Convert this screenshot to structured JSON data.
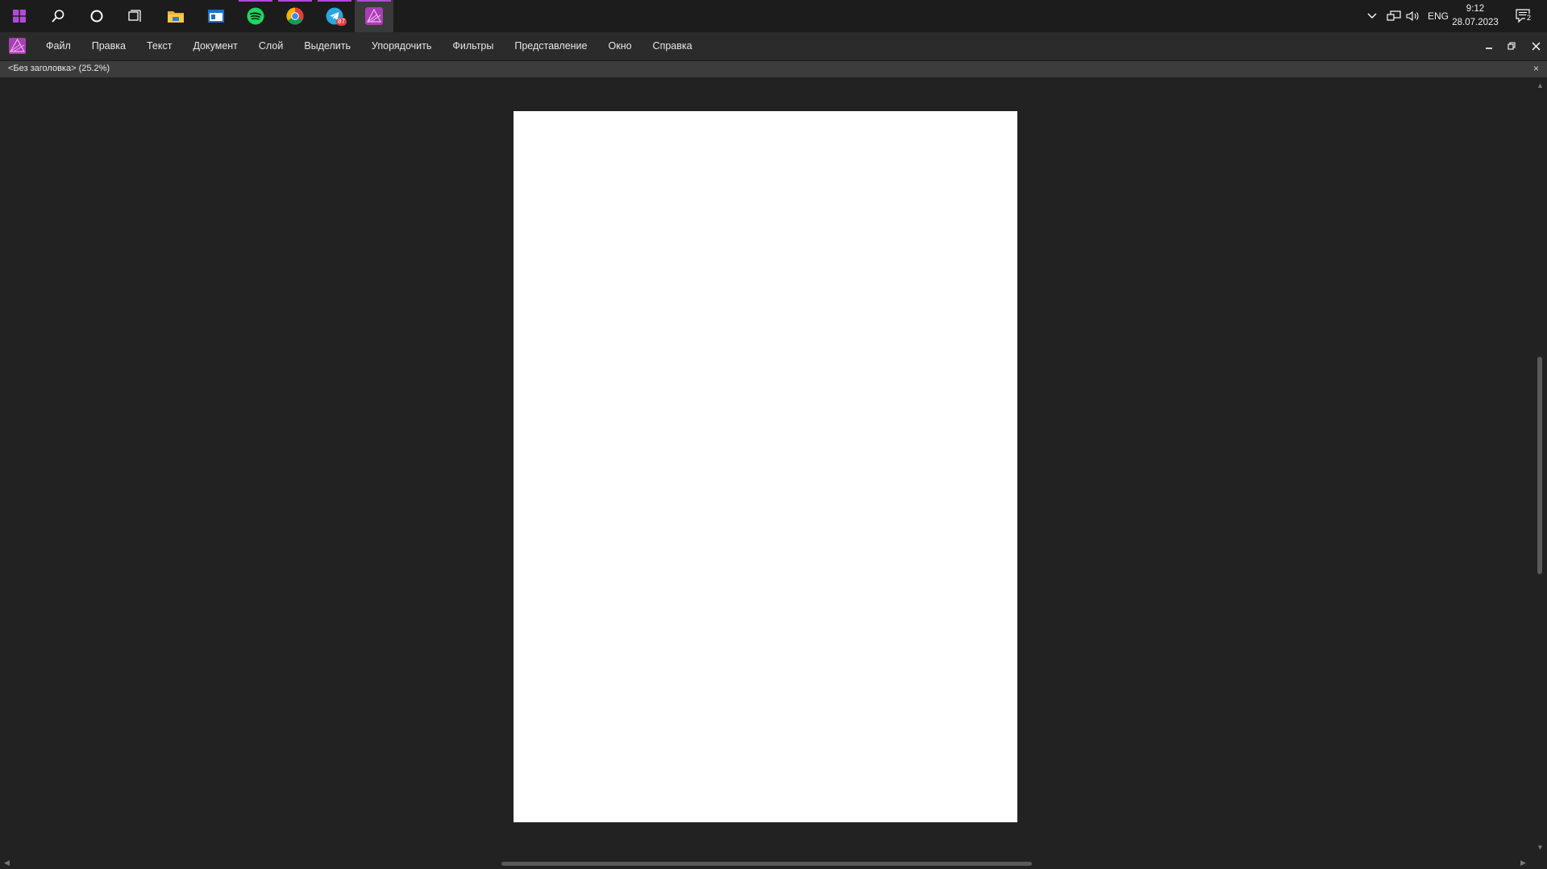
{
  "taskbar": {
    "icons": [
      "windows-start-icon",
      "search-icon",
      "cortana-icon",
      "task-view-icon",
      "file-explorer-icon",
      "app-window-icon",
      "spotify-icon",
      "chrome-icon",
      "telegram-icon",
      "affinity-publisher-icon"
    ],
    "telegram_badge": "87",
    "language": "ENG",
    "time": "9:12",
    "date": "28.07.2023",
    "notifications_badge": "2"
  },
  "menu": {
    "items": [
      "Файл",
      "Правка",
      "Текст",
      "Документ",
      "Слой",
      "Выделить",
      "Упорядочить",
      "Фильтры",
      "Представление",
      "Окно",
      "Справка"
    ]
  },
  "document": {
    "tab_title": "<Без заголовка> (25.2%)",
    "close_glyph": "×"
  },
  "colors": {
    "accent": "#b04ad8",
    "workspace": "#222222",
    "taskbar": "#1c1c1c",
    "menubar": "#2b2b2b",
    "tabbar": "#3c3c3c",
    "page": "#ffffff"
  }
}
